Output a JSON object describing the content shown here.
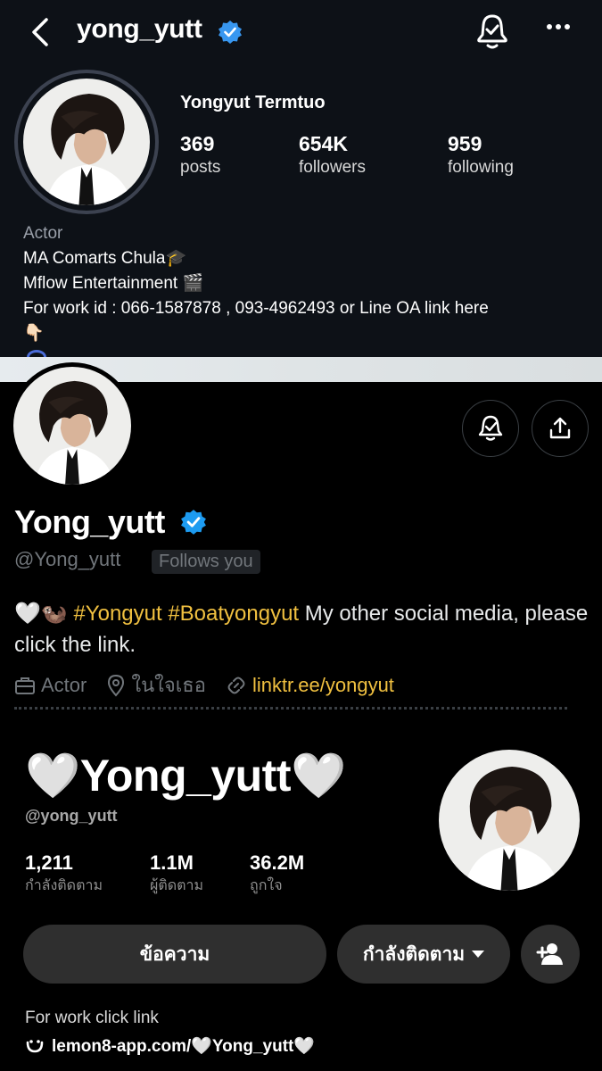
{
  "instagram": {
    "username": "yong_yutt",
    "full_name": "Yongyut Termtuo",
    "stats": [
      {
        "value": "369",
        "label": "posts"
      },
      {
        "value": "654K",
        "label": "followers"
      },
      {
        "value": "959",
        "label": "following"
      }
    ],
    "category": "Actor",
    "bio_lines": [
      "MA Comarts Chula🎓",
      "Mflow Entertainment 🎬",
      "For work id : 066-1587878 , 093-4962493 or Line OA link here",
      "👇🏻"
    ]
  },
  "twitter": {
    "display_name": "Yong_yutt",
    "handle": "@Yong_yutt",
    "follows_you": "Follows you",
    "bio_prefix": "🤍🦦 ",
    "bio_hashtags": "#Yongyut #Boatyongyut",
    "bio_text": " My other social media, please click the link.",
    "profession": "Actor",
    "location": "ในใจเธอ",
    "website": "linktr.ee/yongyut"
  },
  "tiktok": {
    "display_name": "🤍Yong_yutt🤍",
    "handle": "@yong_yutt",
    "stats": [
      {
        "value": "1,211",
        "label": "กำลังติดตาม"
      },
      {
        "value": "1.1M",
        "label": "ผู้ติดตาม"
      },
      {
        "value": "36.2M",
        "label": "ถูกใจ"
      }
    ],
    "message_button": "ข้อความ",
    "following_button": "กำลังติดตาม",
    "bio_text": "For work click link",
    "link": "lemon8-app.com/🤍Yong_yutt🤍"
  },
  "colors": {
    "ig_bg": "#0d1117",
    "twitter_verified": "#1d9bf0",
    "hashtag": "#f0c040",
    "tiktok_button": "#2f2f2f"
  }
}
